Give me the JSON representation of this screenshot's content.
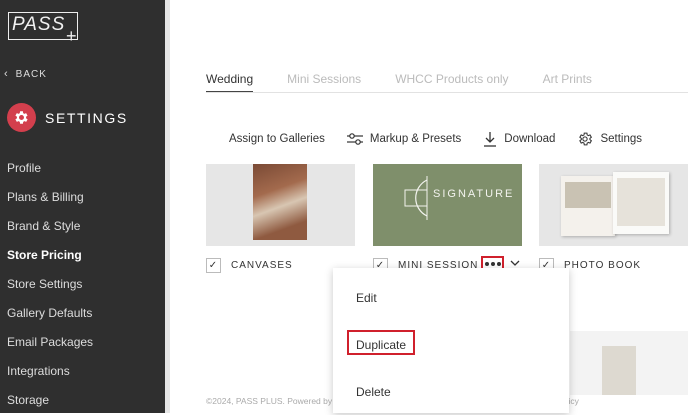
{
  "brand": {
    "logo_text": "PASS",
    "logo_plus": "+"
  },
  "sidebar": {
    "back_label": "BACK",
    "section_title": "SETTINGS",
    "items": [
      {
        "label": "Profile",
        "active": false
      },
      {
        "label": "Plans & Billing",
        "active": false
      },
      {
        "label": "Brand & Style",
        "active": false
      },
      {
        "label": "Store Pricing",
        "active": true
      },
      {
        "label": "Store Settings",
        "active": false
      },
      {
        "label": "Gallery Defaults",
        "active": false
      },
      {
        "label": "Email Packages",
        "active": false
      },
      {
        "label": "Integrations",
        "active": false
      },
      {
        "label": "Storage",
        "active": false
      }
    ]
  },
  "tabs": [
    {
      "label": "Wedding",
      "active": true
    },
    {
      "label": "Mini Sessions",
      "active": false
    },
    {
      "label": "WHCC Products only",
      "active": false
    },
    {
      "label": "Art Prints",
      "active": false
    }
  ],
  "toolbar": {
    "assign": "Assign to Galleries",
    "markup": "Markup & Presets",
    "download": "Download",
    "settings": "Settings"
  },
  "cards": [
    {
      "label": "CANVASES",
      "checked": true
    },
    {
      "label": "MINI SESSION",
      "checked": true,
      "image_text": "SIGNATURE"
    },
    {
      "label": "PHOTO BOOK",
      "checked": true
    }
  ],
  "menu": {
    "edit": "Edit",
    "duplicate": "Duplicate",
    "delete": "Delete"
  },
  "footer": "©2024, PASS PLUS. Powered by Pic-Time. All Rights Reserved.  |  Terms of Service  |  Privacy Policy",
  "colors": {
    "sidebar_bg": "#2f2f2f",
    "accent": "#d33f4d",
    "highlight_border": "#d0202c",
    "sage": "#7f8f6b"
  }
}
